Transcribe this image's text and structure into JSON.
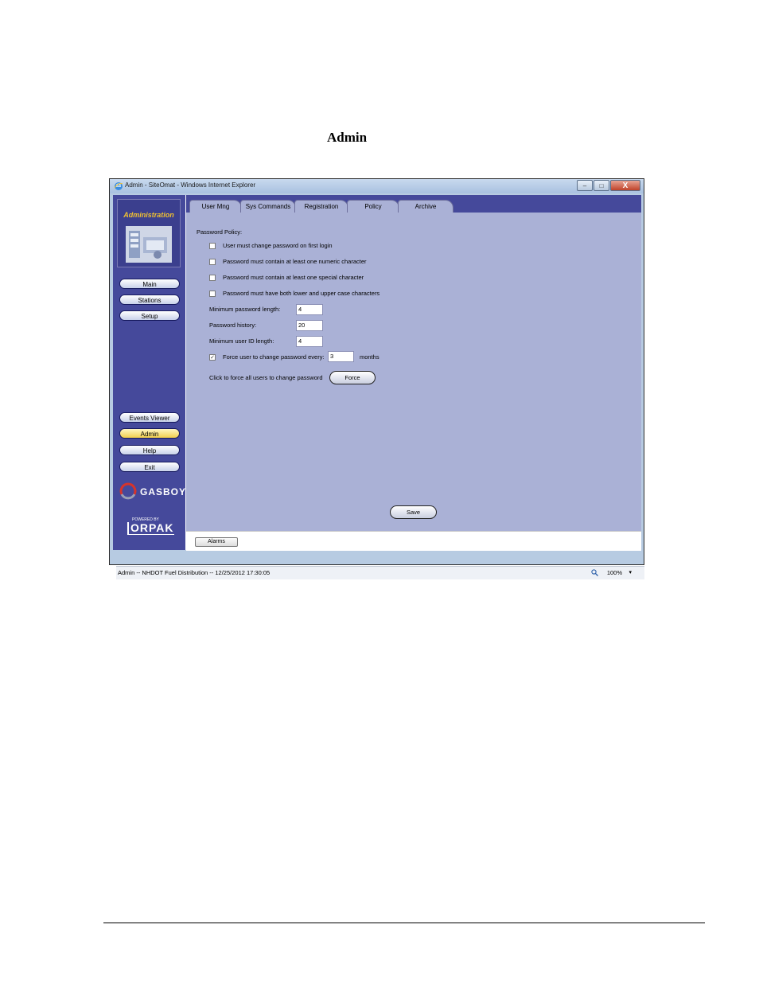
{
  "document": {
    "heading": "Admin"
  },
  "window": {
    "title": "Admin - SiteOmat - Windows Internet Explorer",
    "controls": {
      "minimize": "–",
      "maximize": "□",
      "close": "X"
    }
  },
  "sidebar": {
    "logo_label": "Administration",
    "nav": [
      "Main",
      "Stations",
      "Setup"
    ],
    "bottom_nav": [
      "Events Viewer",
      "Admin",
      "Help",
      "Exit"
    ],
    "active": "Admin",
    "brand": "GASBOY",
    "powered_by": "POWERED BY",
    "vendor": "ORPAK"
  },
  "tabs": {
    "items": [
      "User Mng",
      "Sys Commands",
      "Registration",
      "Policy",
      "Archive"
    ],
    "active": "Policy"
  },
  "policy": {
    "section_title": "Password Policy:",
    "checkboxes": [
      {
        "label": "User must change password on first login",
        "checked": false
      },
      {
        "label": "Password must contain at least one numeric character",
        "checked": false
      },
      {
        "label": "Password must contain at least one special character",
        "checked": false
      },
      {
        "label": "Password must have both lower and upper case characters",
        "checked": false
      }
    ],
    "min_length_label": "Minimum password length:",
    "min_length_value": "4",
    "history_label": "Password history:",
    "history_value": "20",
    "min_userid_label": "Minimum user ID length:",
    "min_userid_value": "4",
    "force_change_label": "Force user to change password every:",
    "force_change_checked": true,
    "force_change_value": "3",
    "force_change_unit": "months",
    "force_all_label": "Click to force all users to change password",
    "force_button": "Force",
    "save_button": "Save",
    "check_mark": "✓"
  },
  "bottom": {
    "alarms_button": "Alarms"
  },
  "status": {
    "text": "Admin -- NHDOT Fuel Distribution -- 12/25/2012  17:30:05",
    "zoom": "100%",
    "zoom_arrow": "▾"
  }
}
